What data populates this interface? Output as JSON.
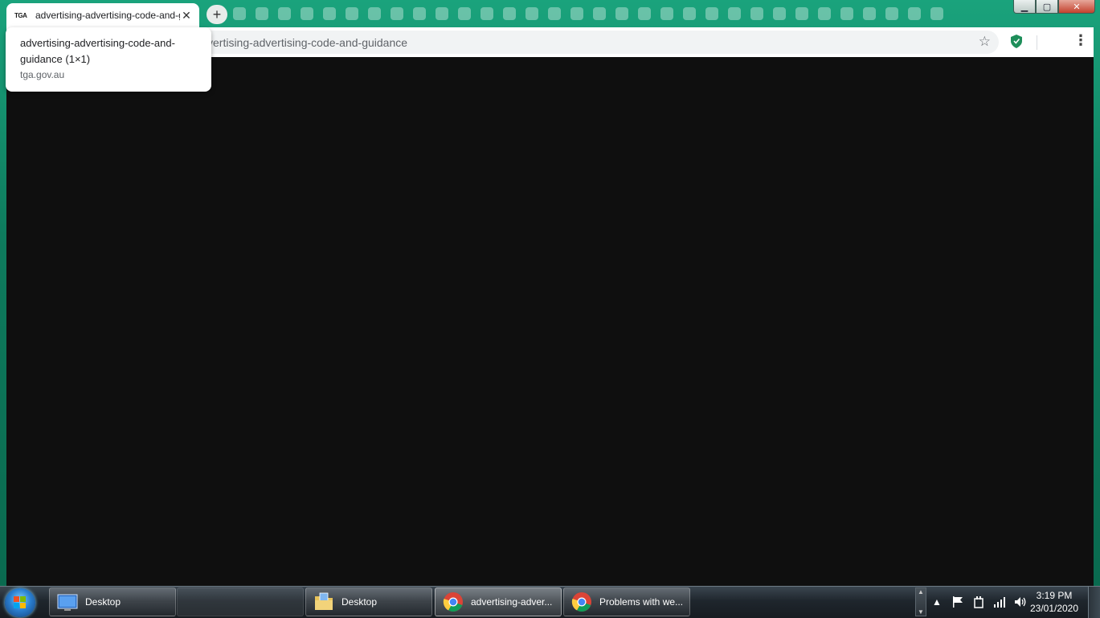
{
  "browser": {
    "tab": {
      "favicon_text": "TGA",
      "title": "advertising-advertising-code-and-guidance",
      "close_glyph": "✕"
    },
    "new_tab_glyph": "+",
    "address_bar_text": "vertising-advertising-code-and-guidance",
    "hover_card": {
      "title": "advertising-advertising-code-and-guidance (1×1)",
      "domain": "tga.gov.au"
    },
    "menu_glyph": "⋮",
    "star_glyph": "☆"
  },
  "window_controls": {
    "minimize": "▁",
    "maximize": "▢",
    "close": "✕"
  },
  "taskbar": {
    "buttons": [
      {
        "label": "Desktop",
        "icon": "desktop-icon"
      },
      {
        "label": "",
        "icon": ""
      },
      {
        "label": "Desktop",
        "icon": "folder-icon"
      },
      {
        "label": "advertising-adver...",
        "icon": "chrome-icon"
      },
      {
        "label": "Problems with we...",
        "icon": "chrome-icon"
      }
    ],
    "clock": {
      "time": "3:19 PM",
      "date": "23/01/2020"
    },
    "tray_icons": [
      "show-hidden-icon",
      "flag-icon",
      "power-icon",
      "signal-icon",
      "volume-icon"
    ]
  },
  "colors": {
    "frame": "#0e7b5d",
    "viewport": "#0f0f0f",
    "taskbar": "#1f262d",
    "shield": "#1e8e5a"
  }
}
